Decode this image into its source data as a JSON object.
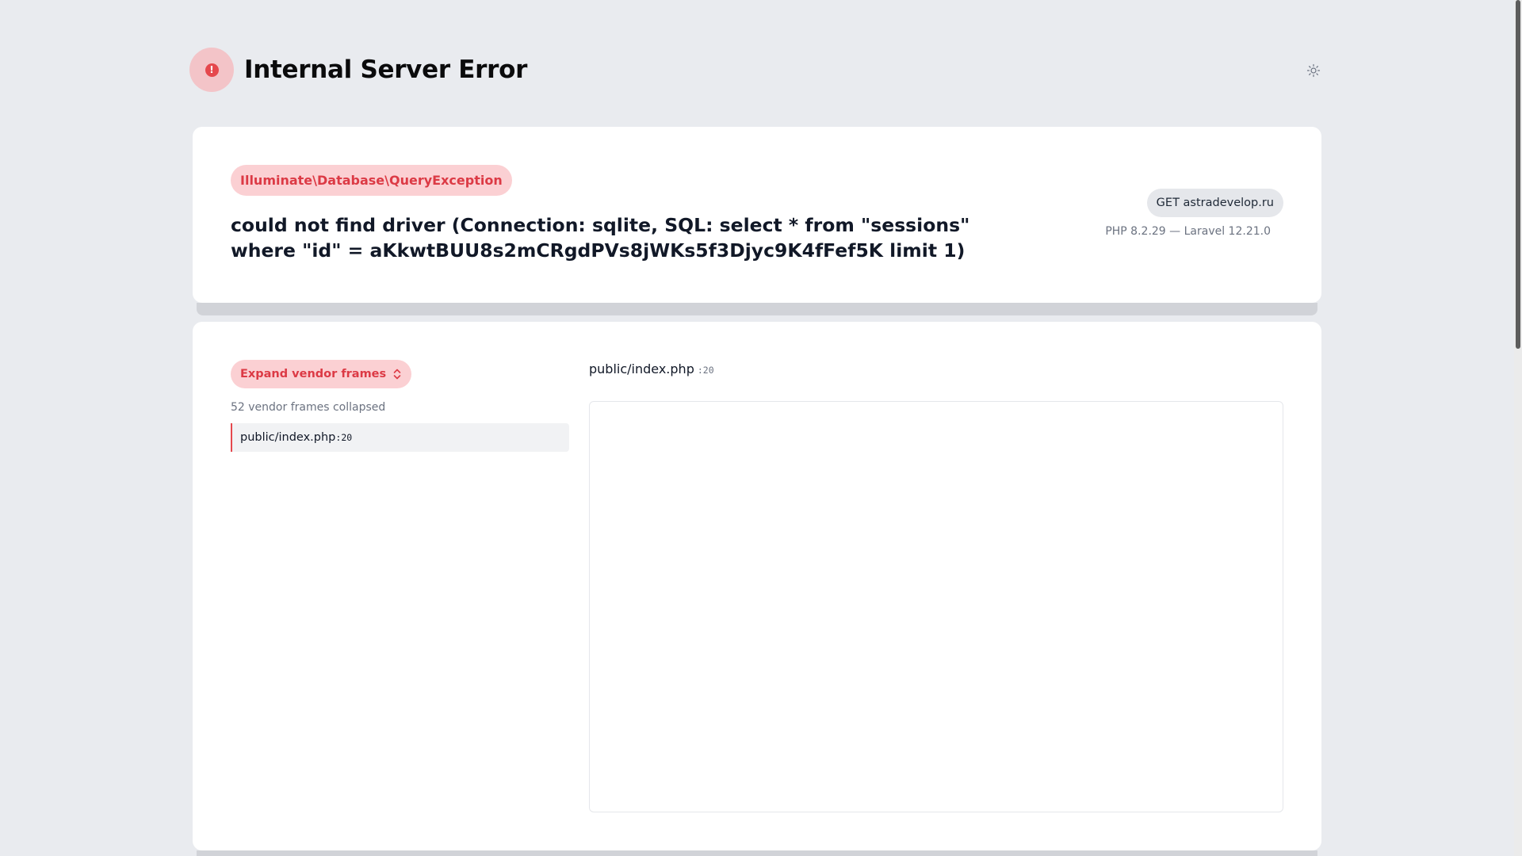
{
  "header": {
    "title": "Internal Server Error",
    "error_icon": "exclamation-icon",
    "theme_icon": "sun-icon"
  },
  "exception": {
    "class": "Illuminate\\Database\\QueryException",
    "message": "could not find driver (Connection: sqlite, SQL: select * from \"sessions\" where \"id\" = aKkwtBUU8s2mCRgdPVs8jWKs5f3Djyc9K4fFef5K limit 1)",
    "request": "GET astradevelop.ru",
    "versions": "PHP 8.2.29 — Laravel 12.21.0"
  },
  "trace": {
    "expand_label": "Expand vendor frames",
    "collapsed_note": "52 vendor frames collapsed",
    "frames": [
      {
        "file": "public/index.php",
        "line": ":20"
      }
    ]
  },
  "code": {
    "file": "public/index.php",
    "line": ":20"
  },
  "colors": {
    "accent_red": "#e5484d",
    "pill_bg": "#fbd0d3",
    "page_bg": "#e9ebef"
  }
}
